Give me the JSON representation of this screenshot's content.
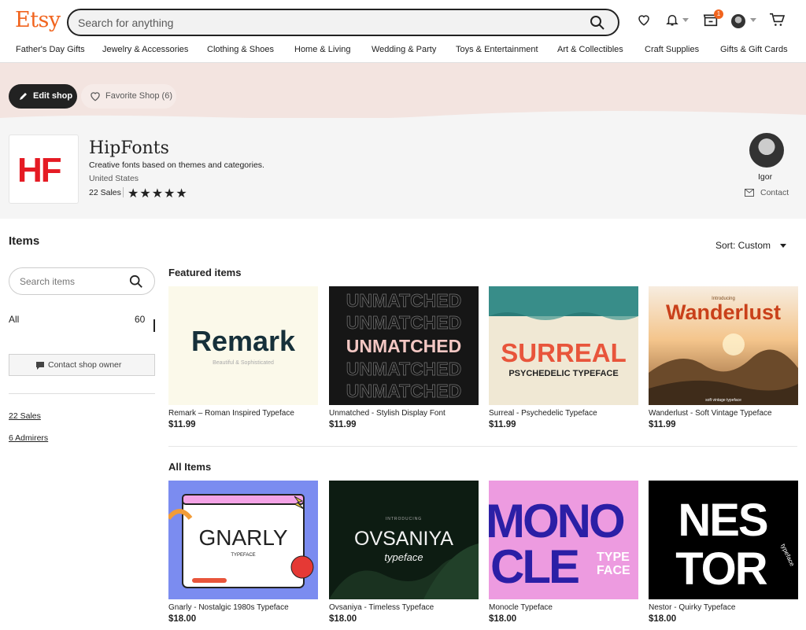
{
  "header": {
    "logo": "Etsy",
    "search_placeholder": "Search for anything",
    "cart_badge": "1",
    "nav": [
      "Father's Day Gifts",
      "Jewelry & Accessories",
      "Clothing & Shoes",
      "Home & Living",
      "Wedding & Party",
      "Toys & Entertainment",
      "Art & Collectibles",
      "Craft Supplies",
      "Gifts & Gift Cards"
    ]
  },
  "banner": {
    "edit_shop": "Edit shop",
    "favorite_shop": "Favorite Shop (6)"
  },
  "shop": {
    "logo_text": "HF",
    "name": "HipFonts",
    "tagline": "Creative fonts based on themes and categories.",
    "location": "United States",
    "sales": "22 Sales",
    "stars": "★★★★★",
    "owner_name": "Igor",
    "contact": "Contact"
  },
  "sidebar": {
    "title": "Items",
    "search_placeholder": "Search items",
    "all_label": "All",
    "all_count": "60",
    "contact_owner": "Contact shop owner",
    "sales_link": "22 Sales",
    "admirers_link": "6 Admirers"
  },
  "main": {
    "sort": "Sort: Custom",
    "featured_title": "Featured items",
    "all_title": "All Items",
    "featured": [
      {
        "title": "Remark – Roman Inspired Typeface",
        "price": "$11.99",
        "art": "Remark",
        "art_sub": "Beautiful & Sophisticated"
      },
      {
        "title": "Unmatched - Stylish Display Font",
        "price": "$11.99",
        "art": "UNMATCHED"
      },
      {
        "title": "Surreal - Psychedelic Typeface",
        "price": "$11.99",
        "art": "SURREAL",
        "art_sub": "PSYCHEDELIC TYPEFACE"
      },
      {
        "title": "Wanderlust - Soft Vintage Typeface",
        "price": "$11.99",
        "art": "Wanderlust",
        "art_pre": "Introducing",
        "art_sub": "soft vintage typeface"
      }
    ],
    "all": [
      {
        "title": "Gnarly - Nostalgic 1980s Typeface",
        "price": "$18.00",
        "art": "GNARLY",
        "art_sub": "TYPEFACE"
      },
      {
        "title": "Ovsaniya - Timeless Typeface",
        "price": "$18.00",
        "art": "OVSANIYA",
        "art_pre": "INTRODUCING",
        "art_sub": "typeface"
      },
      {
        "title": "Monocle Typeface",
        "price": "$18.00",
        "art": "MONO",
        "art2": "CLE",
        "art_sub": "TYPE",
        "art_sub2": "FACE"
      },
      {
        "title": "Nestor - Quirky Typeface",
        "price": "$18.00",
        "art": "NES",
        "art2": "TOR",
        "art_sub": "typeface"
      }
    ]
  },
  "colors": {
    "brand": "#f1641e",
    "banner": "#f3e4e0",
    "shop_logo_red": "#e51b24"
  }
}
